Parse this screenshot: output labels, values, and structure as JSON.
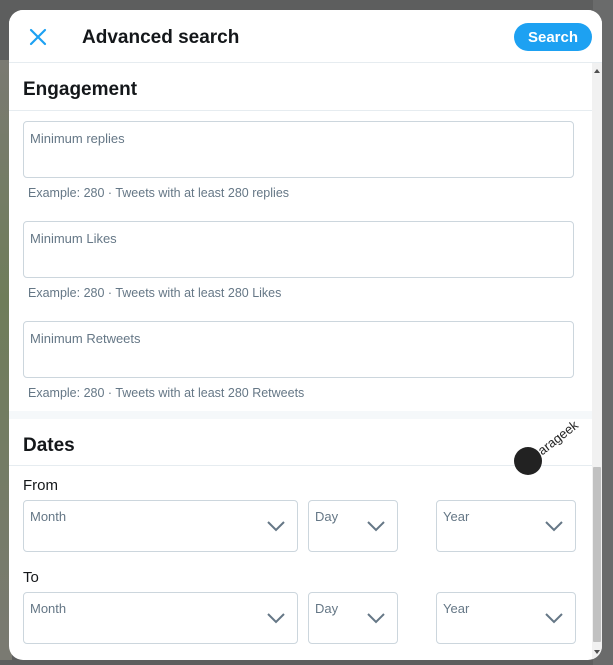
{
  "modal": {
    "title": "Advanced search",
    "search_label": "Search"
  },
  "engagement": {
    "heading": "Engagement",
    "fields": [
      {
        "label": "Minimum replies",
        "hint": "Example: 280 · Tweets with at least 280 replies"
      },
      {
        "label": "Minimum Likes",
        "hint": "Example: 280 · Tweets with at least 280 Likes"
      },
      {
        "label": "Minimum Retweets",
        "hint": "Example: 280 · Tweets with at least 280 Retweets"
      }
    ]
  },
  "dates": {
    "heading": "Dates",
    "from_label": "From",
    "to_label": "To",
    "from": {
      "month": "Month",
      "day": "Day",
      "year": "Year"
    },
    "to": {
      "month": "Month",
      "day": "Day",
      "year": "Year"
    }
  },
  "watermark": {
    "text": "arageek"
  },
  "icons": {
    "close": "close-icon",
    "chevron": "chevron-down-icon"
  },
  "colors": {
    "accent": "#1da1f2",
    "text": "#14171a",
    "muted": "#657786",
    "border": "#ccd6dd"
  }
}
